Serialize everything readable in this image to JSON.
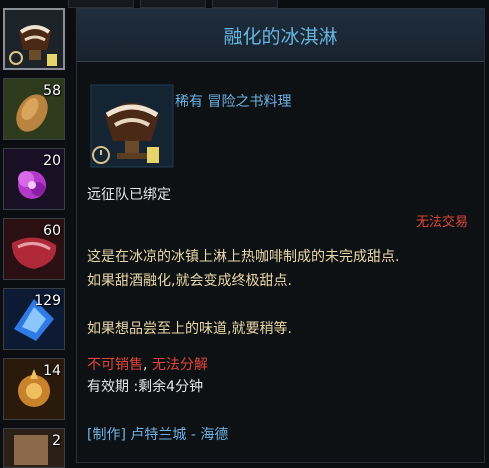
{
  "inventory": [
    {
      "name": "melting-ice-cream",
      "count": ""
    },
    {
      "name": "almond",
      "count": "58"
    },
    {
      "name": "purple-flower",
      "count": "20"
    },
    {
      "name": "raw-meat",
      "count": "60"
    },
    {
      "name": "blue-crystal",
      "count": "129"
    },
    {
      "name": "golden-ornament",
      "count": "14"
    },
    {
      "name": "scroll",
      "count": "2"
    }
  ],
  "tooltip": {
    "title": "融化的冰淇淋",
    "rarity": "稀有",
    "category": "冒险之书料理",
    "bind": "远征队已绑定",
    "trade": "无法交易",
    "desc1": "这是在冰凉的冰镇上淋上热咖啡制成的未完成甜点.",
    "desc2": "如果甜酒融化,就会变成终极甜点.",
    "desc3": "如果想品尝至上的味道,就要稍等.",
    "nosell": "不可销售",
    "sep": ",",
    "nodismantle": "无法分解",
    "expire": "有效期 :剩余4分钟",
    "craft_tag": "[制作]",
    "craft_place": "卢特兰城 - 海德"
  }
}
